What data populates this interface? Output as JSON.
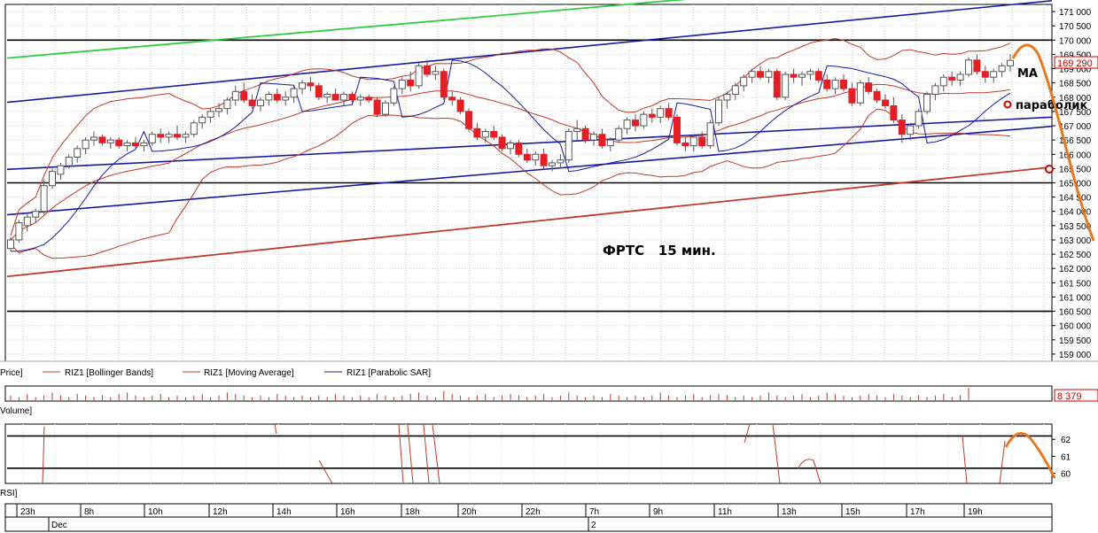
{
  "chart_data": {
    "type": "candlestick",
    "annotation": "ФРТС   15 мин.",
    "price_axis": {
      "ylim": [
        158750,
        171250
      ],
      "ticks": [
        "171 000",
        "170 500",
        "170 000",
        "169 500",
        "169 000",
        "168 500",
        "168 000",
        "167 500",
        "167 000",
        "166 500",
        "166 000",
        "165 500",
        "165 000",
        "164 500",
        "164 000",
        "163 500",
        "163 000",
        "162 500",
        "162 000",
        "161 500",
        "161 000",
        "160 500",
        "160 000",
        "159 500",
        "159 000"
      ],
      "tick_values": [
        171000,
        170500,
        170000,
        169500,
        169000,
        168500,
        168000,
        167500,
        167000,
        166500,
        166000,
        165500,
        165000,
        164500,
        164000,
        163500,
        163000,
        162500,
        162000,
        161500,
        161000,
        160500,
        160000,
        159500,
        159000
      ],
      "current_price_label": "169 290",
      "current_price": 169290
    },
    "legend": {
      "price": "Price]",
      "bollinger": "RIZ1 [Bollinger Bands]",
      "ma": "RIZ1 [Moving Average]",
      "sar": "RIZ1 [Parabolic SAR]"
    },
    "labels": {
      "ma": "MA",
      "parabolic": "параболик"
    },
    "volume": {
      "label": "Volume]",
      "current_value": "8 379"
    },
    "rsi": {
      "label": "RSI]",
      "ticks": [
        "62",
        "61",
        "60"
      ],
      "tick_values": [
        62,
        61,
        60
      ],
      "ylim": [
        59.4,
        62.9
      ]
    },
    "time_axis": {
      "labels": [
        "23h",
        "8h",
        "10h",
        "12h",
        "14h",
        "16h",
        "18h",
        "20h",
        "22h",
        "7h",
        "9h",
        "11h",
        "13h",
        "15h",
        "17h",
        "19h"
      ],
      "dates": [
        "Dec",
        "2"
      ]
    },
    "horizontal_levels": [
      170000,
      165000,
      160500
    ],
    "rsi_levels": [
      62.2,
      60.3
    ],
    "candles": [
      [
        162700,
        163100,
        162600,
        163000
      ],
      [
        163000,
        163700,
        162900,
        163600
      ],
      [
        163500,
        163900,
        163300,
        163800
      ],
      [
        163800,
        164100,
        163600,
        164000
      ],
      [
        164000,
        165100,
        163900,
        164900
      ],
      [
        164900,
        165500,
        164800,
        165400
      ],
      [
        165300,
        165700,
        165100,
        165600
      ],
      [
        165600,
        166000,
        165500,
        165900
      ],
      [
        165900,
        166300,
        165700,
        166200
      ],
      [
        166200,
        166600,
        166000,
        166500
      ],
      [
        166500,
        166800,
        166300,
        166600
      ],
      [
        166600,
        166700,
        166300,
        166400
      ],
      [
        166400,
        166600,
        166200,
        166500
      ],
      [
        166500,
        166600,
        166200,
        166300
      ],
      [
        166300,
        166500,
        166100,
        166400
      ],
      [
        166400,
        166600,
        166200,
        166300
      ],
      [
        166300,
        166500,
        166100,
        166400
      ],
      [
        166400,
        166800,
        166300,
        166700
      ],
      [
        166700,
        166900,
        166400,
        166600
      ],
      [
        166600,
        166800,
        166400,
        166700
      ],
      [
        166700,
        167000,
        166500,
        166600
      ],
      [
        166600,
        166800,
        166400,
        166700
      ],
      [
        166700,
        167200,
        166600,
        167100
      ],
      [
        167100,
        167400,
        166900,
        167300
      ],
      [
        167300,
        167600,
        167100,
        167500
      ],
      [
        167500,
        167800,
        167300,
        167600
      ],
      [
        167600,
        168000,
        167400,
        167900
      ],
      [
        167900,
        168400,
        167700,
        168200
      ],
      [
        168200,
        168500,
        167800,
        167900
      ],
      [
        167900,
        168100,
        167600,
        167700
      ],
      [
        167700,
        168000,
        167500,
        167900
      ],
      [
        167900,
        168200,
        167700,
        168100
      ],
      [
        168100,
        168300,
        167800,
        167900
      ],
      [
        167900,
        168200,
        167700,
        168000
      ],
      [
        168000,
        168400,
        167800,
        168300
      ],
      [
        168300,
        168600,
        168100,
        168500
      ],
      [
        168500,
        168700,
        168200,
        168400
      ],
      [
        168400,
        168500,
        167900,
        168000
      ],
      [
        168000,
        168200,
        167800,
        168100
      ],
      [
        168100,
        168300,
        167900,
        167900
      ],
      [
        167900,
        168200,
        167700,
        168100
      ],
      [
        168100,
        168200,
        167800,
        167900
      ],
      [
        167900,
        168100,
        167700,
        168000
      ],
      [
        168000,
        168100,
        167800,
        167900
      ],
      [
        167900,
        168000,
        167300,
        167400
      ],
      [
        167400,
        167900,
        167300,
        167800
      ],
      [
        167800,
        168400,
        167700,
        168300
      ],
      [
        168300,
        168700,
        168100,
        168600
      ],
      [
        168600,
        168900,
        168200,
        168400
      ],
      [
        168400,
        169200,
        168300,
        169100
      ],
      [
        169100,
        169300,
        168700,
        168800
      ],
      [
        168800,
        169100,
        168600,
        168900
      ],
      [
        168900,
        169000,
        167900,
        168000
      ],
      [
        168000,
        168200,
        167700,
        167900
      ],
      [
        167900,
        168000,
        167400,
        167500
      ],
      [
        167500,
        167600,
        166800,
        166900
      ],
      [
        166900,
        167100,
        166500,
        166600
      ],
      [
        166600,
        166900,
        166400,
        166800
      ],
      [
        166800,
        167000,
        166500,
        166600
      ],
      [
        166600,
        166700,
        166100,
        166200
      ],
      [
        166200,
        166500,
        166000,
        166400
      ],
      [
        166400,
        166500,
        165900,
        166000
      ],
      [
        166000,
        166200,
        165700,
        165800
      ],
      [
        165800,
        166100,
        165600,
        166000
      ],
      [
        166000,
        166200,
        165500,
        165600
      ],
      [
        165600,
        165800,
        165400,
        165700
      ],
      [
        165700,
        166000,
        165500,
        165800
      ],
      [
        165800,
        166900,
        165700,
        166800
      ],
      [
        166800,
        167200,
        166500,
        166900
      ],
      [
        166900,
        167000,
        166400,
        166500
      ],
      [
        166500,
        166800,
        166300,
        166700
      ],
      [
        166700,
        166900,
        166200,
        166300
      ],
      [
        166300,
        166600,
        166100,
        166500
      ],
      [
        166500,
        167000,
        166400,
        166900
      ],
      [
        166900,
        167300,
        166700,
        167200
      ],
      [
        167200,
        167400,
        166800,
        167000
      ],
      [
        167000,
        167500,
        166900,
        167400
      ],
      [
        167400,
        167600,
        167100,
        167300
      ],
      [
        167300,
        167700,
        167100,
        167600
      ],
      [
        167600,
        167800,
        167200,
        167300
      ],
      [
        167300,
        167400,
        166300,
        166400
      ],
      [
        166400,
        166600,
        166100,
        166300
      ],
      [
        166300,
        166700,
        166100,
        166600
      ],
      [
        166600,
        166800,
        166200,
        166300
      ],
      [
        166300,
        167200,
        166200,
        167100
      ],
      [
        167100,
        168000,
        167000,
        167900
      ],
      [
        167900,
        168200,
        167600,
        168100
      ],
      [
        168100,
        168500,
        167900,
        168400
      ],
      [
        168400,
        168800,
        168200,
        168700
      ],
      [
        168700,
        169000,
        168500,
        168900
      ],
      [
        168900,
        169100,
        168600,
        168700
      ],
      [
        168700,
        169000,
        168500,
        168900
      ],
      [
        168900,
        169000,
        167900,
        168000
      ],
      [
        168000,
        168900,
        167900,
        168800
      ],
      [
        168800,
        169000,
        168500,
        168700
      ],
      [
        168700,
        168900,
        168400,
        168800
      ],
      [
        168800,
        169000,
        168600,
        168900
      ],
      [
        168900,
        169000,
        168500,
        168600
      ],
      [
        168600,
        168800,
        168200,
        168300
      ],
      [
        168300,
        168700,
        168100,
        168600
      ],
      [
        168600,
        168800,
        168200,
        168300
      ],
      [
        168300,
        168500,
        167700,
        167800
      ],
      [
        167800,
        168600,
        167700,
        168500
      ],
      [
        168500,
        168700,
        168100,
        168200
      ],
      [
        168200,
        168300,
        167800,
        167900
      ],
      [
        167900,
        168100,
        167600,
        167700
      ],
      [
        167700,
        168000,
        167100,
        167200
      ],
      [
        167200,
        167400,
        166400,
        166700
      ],
      [
        166700,
        167100,
        166500,
        167000
      ],
      [
        167000,
        167600,
        166900,
        167500
      ],
      [
        167500,
        168200,
        167400,
        168100
      ],
      [
        168100,
        168500,
        167900,
        168400
      ],
      [
        168400,
        168800,
        168200,
        168700
      ],
      [
        168700,
        168900,
        168400,
        168600
      ],
      [
        168600,
        168900,
        168400,
        168800
      ],
      [
        168800,
        169400,
        168700,
        169300
      ],
      [
        169300,
        169500,
        168800,
        168900
      ],
      [
        168900,
        169100,
        168500,
        168700
      ],
      [
        168700,
        169000,
        168500,
        168900
      ],
      [
        168900,
        169200,
        168700,
        169100
      ],
      [
        169100,
        169500,
        168900,
        169290
      ]
    ],
    "volume_bars": [
      3,
      2,
      4,
      2,
      3,
      5,
      3,
      2,
      4,
      3,
      2,
      3,
      2,
      4,
      5,
      3,
      2,
      3,
      4,
      2,
      3,
      2,
      3,
      4,
      2,
      3,
      5,
      4,
      3,
      2,
      3,
      2,
      4,
      3,
      2,
      3,
      2,
      3,
      2,
      4,
      3,
      2,
      3,
      2,
      4,
      3,
      2,
      3,
      4,
      5,
      3,
      2,
      6,
      4,
      3,
      2,
      3,
      4,
      2,
      3,
      4,
      3,
      2,
      3,
      4,
      2,
      3,
      5,
      3,
      2,
      3,
      2,
      4,
      3,
      2,
      3,
      2,
      3,
      5,
      3,
      2,
      3,
      4,
      2,
      3,
      4,
      3,
      2,
      3,
      2,
      3,
      5,
      3,
      2,
      3,
      4,
      2,
      3,
      5,
      4,
      3,
      2,
      3,
      4,
      3,
      2,
      4,
      3,
      2,
      3,
      2,
      3,
      4,
      2,
      3,
      8
    ]
  }
}
